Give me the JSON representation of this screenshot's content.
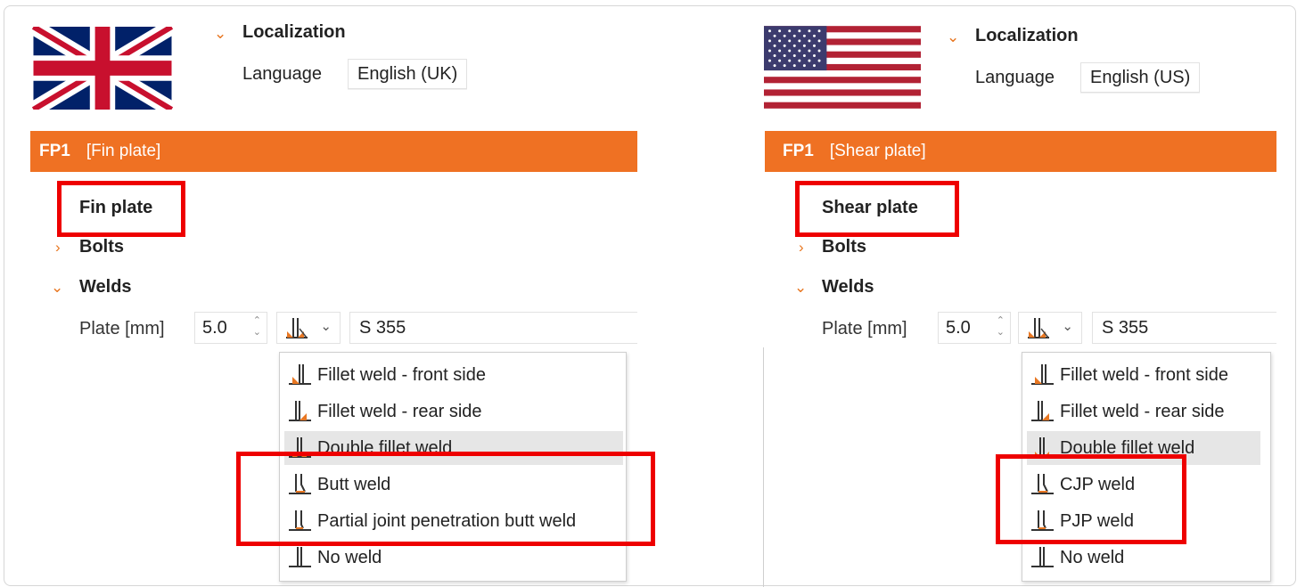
{
  "localization_title": "Localization",
  "language_label": "Language",
  "uk": {
    "language_value": "English (UK)",
    "header": {
      "id": "FP1",
      "type": "[Fin plate]"
    },
    "tree": {
      "plate": "Fin plate",
      "bolts": "Bolts",
      "welds": "Welds"
    },
    "plate_row": {
      "label": "Plate [mm]",
      "thickness": "5.0",
      "material": "S 355"
    },
    "weld_options": [
      "Fillet weld - front side",
      "Fillet weld - rear side",
      "Double fillet weld",
      "Butt weld",
      "Partial joint penetration butt weld",
      "No weld"
    ]
  },
  "us": {
    "language_value": "English (US)",
    "header": {
      "id": "FP1",
      "type": "[Shear plate]"
    },
    "tree": {
      "plate": "Shear plate",
      "bolts": "Bolts",
      "welds": "Welds"
    },
    "plate_row": {
      "label": "Plate [mm]",
      "thickness": "5.0",
      "material": "S 355"
    },
    "weld_options": [
      "Fillet weld - front side",
      "Fillet weld - rear side",
      "Double fillet weld",
      "CJP weld",
      "PJP weld",
      "No weld"
    ]
  },
  "colors": {
    "accent_orange": "#ef7123",
    "highlight_red": "#e00000",
    "hover_gray": "#e6e6e6"
  },
  "icons": {
    "weld_type_select": "fillet-weld-icon",
    "fillet_front": "fillet-weld-front-icon",
    "fillet_rear": "fillet-weld-rear-icon",
    "double_fillet": "double-fillet-weld-icon",
    "butt": "butt-weld-icon",
    "partial_butt": "partial-butt-weld-icon",
    "no_weld": "no-weld-icon"
  }
}
